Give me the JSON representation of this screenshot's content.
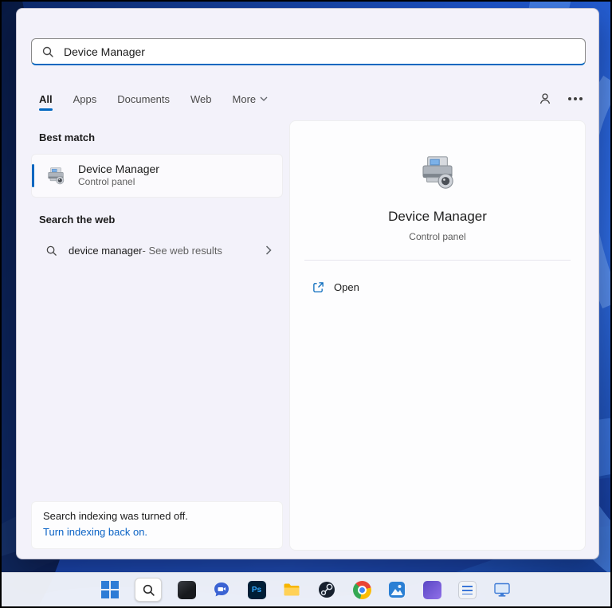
{
  "search": {
    "value": "Device Manager",
    "icon": "magnifier"
  },
  "tabs": {
    "all": "All",
    "apps": "Apps",
    "documents": "Documents",
    "web": "Web",
    "more": "More"
  },
  "header_actions": {
    "account_icon": "person",
    "menu_icon": "ellipsis"
  },
  "left_pane": {
    "best_match_heading": "Best match",
    "best_match": {
      "title": "Device Manager",
      "subtitle": "Control panel",
      "icon": "device-manager-printer"
    },
    "search_web_heading": "Search the web",
    "web_result": {
      "query": "device manager",
      "suffix": " - See web results",
      "icon": "magnifier",
      "chevron": "chevron-right"
    },
    "notice": {
      "line1": "Search indexing was turned off.",
      "link": "Turn indexing back on."
    }
  },
  "preview": {
    "title": "Device Manager",
    "subtitle": "Control panel",
    "icon": "device-manager-printer",
    "open_label": "Open",
    "open_icon": "open-external"
  },
  "taskbar": {
    "photoshop_label": "Ps",
    "icons": [
      "start",
      "search-active",
      "dark-app",
      "teams-chat",
      "photoshop",
      "file-explorer",
      "steam",
      "chrome",
      "photos",
      "media-app",
      "notes-app",
      "monitor"
    ]
  },
  "colors": {
    "accent": "#0067c0",
    "link": "#0b63c5",
    "panel_bg": "#f3f2fa",
    "taskbar_bg": "#f1f3f9",
    "wallpaper_blue": "#1b4fd8"
  }
}
